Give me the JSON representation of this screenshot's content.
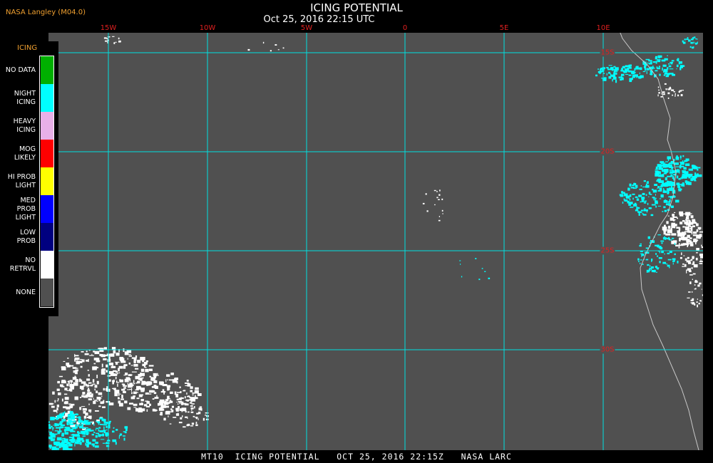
{
  "header": {
    "source": "NASA Langley (M04.0)",
    "title": "ICING POTENTIAL",
    "subtitle": "Oct 25, 2016 22:15 UTC"
  },
  "longitude_labels": [
    "15W",
    "10W",
    "5W",
    "0",
    "5E",
    "10E"
  ],
  "latitude_labels": [
    "15S",
    "20S",
    "25S",
    "30S"
  ],
  "legend": {
    "title": "ICING",
    "items": [
      {
        "label": [
          "NO DATA"
        ],
        "color": "#00b000"
      },
      {
        "label": [
          "NIGHT",
          "ICING"
        ],
        "color": "#00ffff"
      },
      {
        "label": [
          "HEAVY",
          "ICING"
        ],
        "color": "#e8b0e8"
      },
      {
        "label": [
          "MOG",
          "LIKELY"
        ],
        "color": "#ff0000"
      },
      {
        "label": [
          "HI PROB",
          "LIGHT"
        ],
        "color": "#ffff00"
      },
      {
        "label": [
          "MED PROB",
          "LIGHT"
        ],
        "color": "#0000ff"
      },
      {
        "label": [
          "LOW",
          "PROB"
        ],
        "color": "#000080"
      },
      {
        "label": [
          "NO",
          "RETRVL"
        ],
        "color": "#ffffff"
      },
      {
        "label": [
          "NONE"
        ],
        "color": "#505050"
      }
    ]
  },
  "footer": "MT10  ICING POTENTIAL   OCT 25, 2016 22:15Z   NASA LARC",
  "colors": {
    "background": "#505050",
    "grid": "#00e0e0",
    "coastline": "#c0c0c0",
    "label": "#e02020",
    "accent": "#f0a030"
  }
}
